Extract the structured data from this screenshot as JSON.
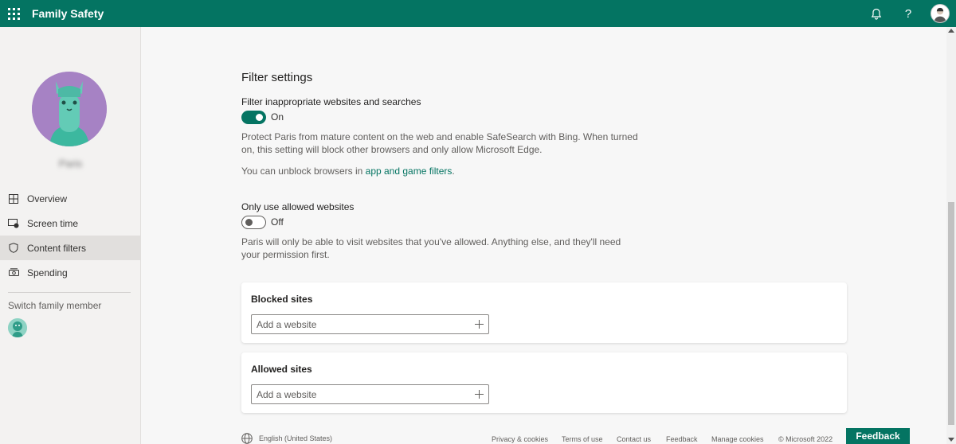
{
  "app": {
    "title": "Family Safety",
    "accent": "#047462"
  },
  "topbar": {
    "help_label": "?"
  },
  "sidebar": {
    "profile_name": "Paris",
    "nav": [
      {
        "label": "Overview",
        "icon": "dashboard-icon"
      },
      {
        "label": "Screen time",
        "icon": "screen-time-icon"
      },
      {
        "label": "Content filters",
        "icon": "shield-icon",
        "active": true
      },
      {
        "label": "Spending",
        "icon": "money-icon"
      }
    ],
    "switch_label": "Switch family member"
  },
  "filter": {
    "section_title": "Filter settings",
    "filter_label": "Filter inappropriate websites and searches",
    "filter_state": "On",
    "filter_desc": "Protect Paris from mature content on the web and enable SafeSearch with Bing. When turned on, this setting will block other browsers and only allow Microsoft Edge.",
    "unblock_text": "You can unblock browsers in ",
    "unblock_link": "app and game filters",
    "unblock_end": ".",
    "allowed_only_label": "Only use allowed websites",
    "allowed_only_state": "Off",
    "allowed_only_desc": "Paris will only be able to visit websites that you've allowed. Anything else, and they'll need your permission first."
  },
  "blocked": {
    "title": "Blocked sites",
    "placeholder": "Add a website"
  },
  "allowed": {
    "title": "Allowed sites",
    "placeholder": "Add a website"
  },
  "footer": {
    "language": "English (United States)",
    "links": [
      "Privacy & cookies",
      "Terms of use",
      "Contact us",
      "Feedback",
      "Manage cookies",
      "© Microsoft 2022"
    ],
    "feedback_button": "Feedback"
  }
}
